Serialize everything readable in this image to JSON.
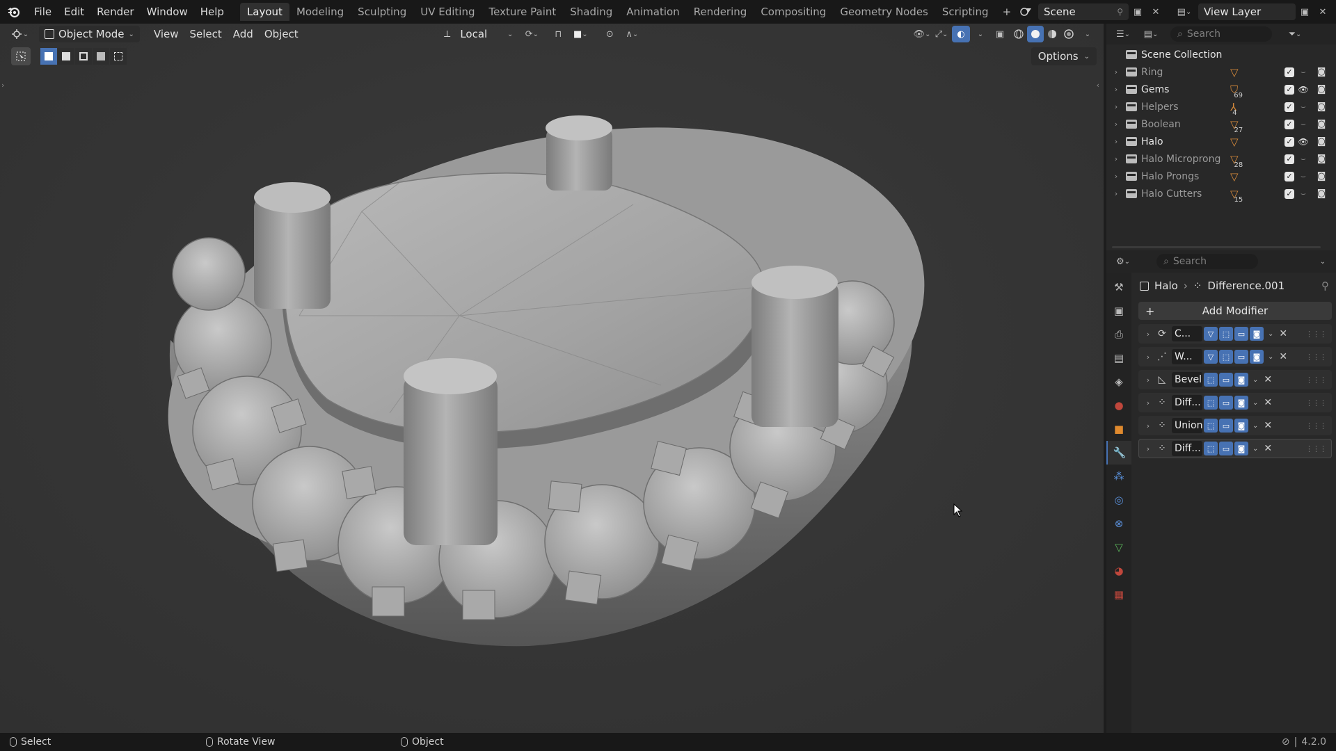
{
  "menu": [
    "File",
    "Edit",
    "Render",
    "Window",
    "Help"
  ],
  "workspaces": [
    {
      "label": "Layout",
      "active": true
    },
    {
      "label": "Modeling",
      "active": false
    },
    {
      "label": "Sculpting",
      "active": false
    },
    {
      "label": "UV Editing",
      "active": false
    },
    {
      "label": "Texture Paint",
      "active": false
    },
    {
      "label": "Shading",
      "active": false
    },
    {
      "label": "Animation",
      "active": false
    },
    {
      "label": "Rendering",
      "active": false
    },
    {
      "label": "Compositing",
      "active": false
    },
    {
      "label": "Geometry Nodes",
      "active": false
    },
    {
      "label": "Scripting",
      "active": false
    }
  ],
  "add_workspace": "+",
  "scene": {
    "name": "Scene",
    "view_layer": "View Layer"
  },
  "viewport": {
    "mode": "Object Mode",
    "menus": [
      "View",
      "Select",
      "Add",
      "Object"
    ],
    "transform_orientation": "Local",
    "options_label": "Options"
  },
  "outliner": {
    "search_placeholder": "Search",
    "root": "Scene Collection",
    "items": [
      {
        "name": "Ring",
        "bright": false,
        "count": "",
        "eye": false
      },
      {
        "name": "Gems",
        "bright": true,
        "count": "69",
        "eye": true
      },
      {
        "name": "Helpers",
        "bright": false,
        "count": "4",
        "eye": false
      },
      {
        "name": "Boolean",
        "bright": false,
        "count": "27",
        "eye": false
      },
      {
        "name": "Halo",
        "bright": true,
        "count": "",
        "eye": true
      },
      {
        "name": "Halo Microprong",
        "bright": false,
        "count": "28",
        "eye": false
      },
      {
        "name": "Halo Prongs",
        "bright": false,
        "count": "",
        "eye": false
      },
      {
        "name": "Halo Cutters",
        "bright": false,
        "count": "15",
        "eye": false
      }
    ]
  },
  "properties": {
    "search_placeholder": "Search",
    "object": "Halo",
    "modifier": "Difference.001",
    "add_modifier": "Add Modifier",
    "modifiers": [
      {
        "name": "C...",
        "icon": "curve",
        "edit": true
      },
      {
        "name": "W...",
        "icon": "weld",
        "edit": true
      },
      {
        "name": "Bevel",
        "icon": "bevel",
        "edit": false
      },
      {
        "name": "Diff...",
        "icon": "boolean",
        "edit": false
      },
      {
        "name": "Union",
        "icon": "boolean",
        "edit": false
      },
      {
        "name": "Diff...",
        "icon": "boolean",
        "edit": false
      }
    ]
  },
  "status": {
    "select": "Select",
    "rotate": "Rotate View",
    "object": "Object",
    "version": "4.2.0"
  },
  "colors": {
    "accent": "#4772b3",
    "orange": "#d4883a",
    "bg": "#1d1d1d",
    "panel": "#282828"
  }
}
